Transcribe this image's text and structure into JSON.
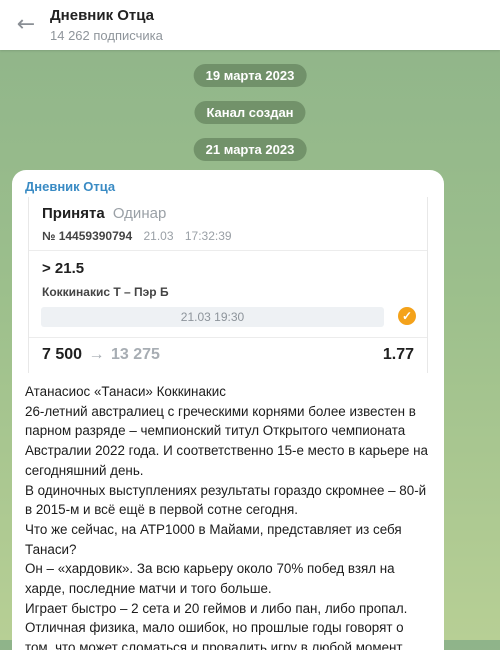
{
  "header": {
    "back_icon": "arrow-left-icon",
    "title": "Дневник Отца",
    "subscribers": "14 262 подписчика"
  },
  "service": {
    "date1": "19 марта 2023",
    "created": "Канал создан",
    "date2": "21 марта 2023"
  },
  "message": {
    "author": "Дневник Отца",
    "bet_card": {
      "status": "Принята",
      "type": "Одинар",
      "number": "№ 14459390794",
      "date": "21.03",
      "time": "17:32:39",
      "selection": "> 21.5",
      "match": "Коккинакис Т – Пэр Б",
      "match_datetime": "21.03 19:30",
      "coin_icon": "bookmaker-coin-icon",
      "stake": "7 500",
      "arrow": "→",
      "win": "13 275",
      "odds": "1.77"
    },
    "paragraphs": [
      "Атанасиос «Танаси» Коккинакис",
      "26-летний австралиец с греческими корнями более известен в парном разряде – чемпионский титул Открытого чемпионата Австралии 2022 года. И соответственно 15-е место в карьере на сегодняшний день.",
      "В одиночных выступлениях результаты гораздо скромнее – 80-й в 2015-м и всё ещё в первой сотне сегодня.",
      "Что же сейчас, на ATP1000 в Майами, представляет из себя Танаси?",
      "Он – «хардовик». За всю карьеру около 70% побед взял на харде, последние матчи и того больше.",
      "Играет быстро – 2 сета и 20 геймов и либо пан, либо пропал.",
      "Отличная физика, мало ошибок, но прошлые годы говорят о том, что может сломаться и провалить игру в любой момент."
    ]
  }
}
